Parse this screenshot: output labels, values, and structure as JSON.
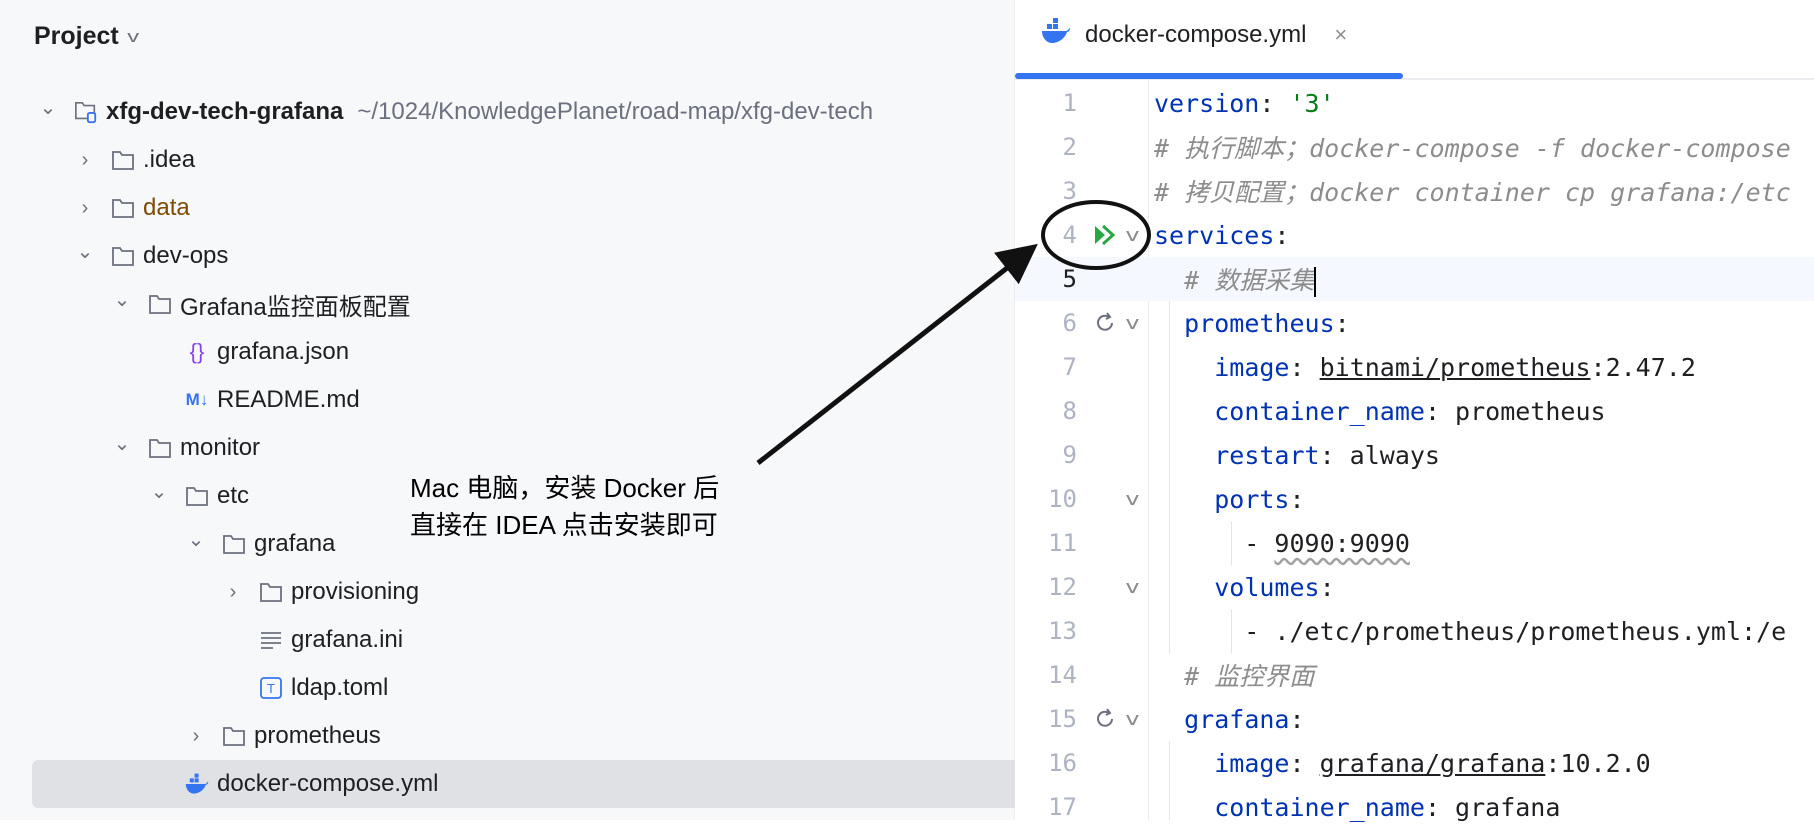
{
  "project_panel": {
    "title": "Project",
    "tree": [
      {
        "level": 0,
        "chevron": "down",
        "icon": "project-folder-icon",
        "label": "xfg-dev-tech-grafana",
        "bold": true,
        "path": "~/1024/KnowledgePlanet/road-map/xfg-dev-tech"
      },
      {
        "level": 1,
        "chevron": "right",
        "icon": "folder-icon",
        "label": ".idea"
      },
      {
        "level": 1,
        "chevron": "right",
        "icon": "folder-icon",
        "label": "data",
        "color": "#7f4b00"
      },
      {
        "level": 1,
        "chevron": "down",
        "icon": "folder-icon",
        "label": "dev-ops"
      },
      {
        "level": 2,
        "chevron": "down",
        "icon": "folder-icon",
        "label": "Grafana监控面板配置"
      },
      {
        "level": 3,
        "chevron": "none",
        "icon": "json-file-icon",
        "label": "grafana.json"
      },
      {
        "level": 3,
        "chevron": "none",
        "icon": "markdown-file-icon",
        "label": "README.md"
      },
      {
        "level": 2,
        "chevron": "down",
        "icon": "folder-icon",
        "label": "monitor"
      },
      {
        "level": 3,
        "chevron": "down",
        "icon": "folder-icon",
        "label": "etc"
      },
      {
        "level": 4,
        "chevron": "down",
        "icon": "folder-icon",
        "label": "grafana"
      },
      {
        "level": 5,
        "chevron": "right",
        "icon": "folder-icon",
        "label": "provisioning"
      },
      {
        "level": 5,
        "chevron": "none",
        "icon": "text-file-icon",
        "label": "grafana.ini"
      },
      {
        "level": 5,
        "chevron": "none",
        "icon": "toml-file-icon",
        "label": "ldap.toml"
      },
      {
        "level": 4,
        "chevron": "right",
        "icon": "folder-icon",
        "label": "prometheus"
      },
      {
        "level": 3,
        "chevron": "none",
        "icon": "docker-icon",
        "label": "docker-compose.yml",
        "selected": true
      }
    ]
  },
  "editor": {
    "tab": {
      "label": "docker-compose.yml",
      "icon": "docker-icon",
      "close": "×"
    },
    "current_line": 5,
    "lines": [
      {
        "n": "1",
        "tokens": [
          [
            "k",
            "version"
          ],
          [
            "p",
            ": "
          ],
          [
            "s",
            "'3'"
          ]
        ]
      },
      {
        "n": "2",
        "tokens": [
          [
            "c",
            "# 执行脚本；docker-compose -f docker-compose"
          ]
        ]
      },
      {
        "n": "3",
        "tokens": [
          [
            "c",
            "# 拷贝配置；docker container cp grafana:/etc"
          ]
        ]
      },
      {
        "n": "4",
        "gutter": "run-all-icon",
        "fold": true,
        "tokens": [
          [
            "k",
            "services"
          ],
          [
            "p",
            ":"
          ]
        ]
      },
      {
        "n": "5",
        "tokens": [
          [
            "p",
            "  "
          ],
          [
            "c",
            "# 数据采集"
          ]
        ],
        "caret": true
      },
      {
        "n": "6",
        "gutter": "restart-icon",
        "fold": true,
        "tokens": [
          [
            "p",
            "  "
          ],
          [
            "k",
            "prometheus"
          ],
          [
            "p",
            ":"
          ]
        ]
      },
      {
        "n": "7",
        "tokens": [
          [
            "p",
            "    "
          ],
          [
            "k",
            "image"
          ],
          [
            "p",
            ": "
          ],
          [
            "u",
            "bitnami/prometheus"
          ],
          [
            "p",
            ":2.47.2"
          ]
        ]
      },
      {
        "n": "8",
        "tokens": [
          [
            "p",
            "    "
          ],
          [
            "k",
            "container_name"
          ],
          [
            "p",
            ": prometheus"
          ]
        ]
      },
      {
        "n": "9",
        "tokens": [
          [
            "p",
            "    "
          ],
          [
            "k",
            "restart"
          ],
          [
            "p",
            ": always"
          ]
        ]
      },
      {
        "n": "10",
        "fold": true,
        "tokens": [
          [
            "p",
            "    "
          ],
          [
            "k",
            "ports"
          ],
          [
            "p",
            ":"
          ]
        ]
      },
      {
        "n": "11",
        "tokens": [
          [
            "p",
            "      - "
          ],
          [
            "w",
            "9090:9090"
          ]
        ]
      },
      {
        "n": "12",
        "fold": true,
        "tokens": [
          [
            "p",
            "    "
          ],
          [
            "k",
            "volumes"
          ],
          [
            "p",
            ":"
          ]
        ]
      },
      {
        "n": "13",
        "tokens": [
          [
            "p",
            "      - ./etc/prometheus/prometheus.yml:/e"
          ]
        ]
      },
      {
        "n": "14",
        "tokens": [
          [
            "p",
            "  "
          ],
          [
            "c",
            "# 监控界面"
          ]
        ]
      },
      {
        "n": "15",
        "gutter": "restart-icon",
        "fold": true,
        "tokens": [
          [
            "p",
            "  "
          ],
          [
            "k",
            "grafana"
          ],
          [
            "p",
            ":"
          ]
        ]
      },
      {
        "n": "16",
        "tokens": [
          [
            "p",
            "    "
          ],
          [
            "k",
            "image"
          ],
          [
            "p",
            ": "
          ],
          [
            "u",
            "grafana/grafana"
          ],
          [
            "p",
            ":10.2.0"
          ]
        ]
      },
      {
        "n": "17",
        "tokens": [
          [
            "p",
            "    "
          ],
          [
            "k",
            "container_name"
          ],
          [
            "p",
            ": grafana"
          ]
        ]
      }
    ]
  },
  "annotation": {
    "line1": "Mac 电脑，安装 Docker 后",
    "line2": "直接在 IDEA 点击安装即可"
  },
  "colors": {
    "accent": "#3574f0",
    "keyword": "#0033b3",
    "string": "#067d17",
    "comment": "#8c8c8c",
    "run": "#28a745"
  }
}
